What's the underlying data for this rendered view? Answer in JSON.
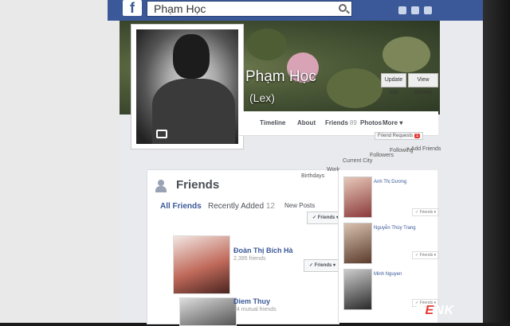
{
  "search": {
    "value": "Phạm Học"
  },
  "logo": {
    "letter": "f"
  },
  "profile": {
    "name": "Phạm Học",
    "alias": "(Lex)"
  },
  "cover_buttons": [
    "Update Info",
    "View Activity"
  ],
  "nav": [
    {
      "label": "Timeline",
      "count": ""
    },
    {
      "label": "About",
      "count": ""
    },
    {
      "label": "Friends",
      "count": "89"
    },
    {
      "label": "Photos",
      "count": ""
    },
    {
      "label": "More ▾",
      "count": ""
    }
  ],
  "friend_requests": {
    "label": "Friend Requests",
    "badge": "1"
  },
  "right_tabs": [
    "+ Add Friends",
    "Following"
  ],
  "friends_section": {
    "title": "Friends",
    "tabs": [
      {
        "label": "All Friends"
      },
      {
        "label": "Recently Added",
        "count": "12"
      },
      {
        "label": "New Posts"
      },
      {
        "label": "Birthdays"
      },
      {
        "label": "Work"
      },
      {
        "label": "Current City"
      },
      {
        "label": "Followers"
      },
      {
        "label": "Following"
      }
    ],
    "list": [
      {
        "name": "Đoàn Thị Bích Hà",
        "sub": "2,395 friends",
        "button": "✓ Friends ▾"
      },
      {
        "name": "Diem Thuy",
        "sub": "24 mutual friends",
        "button": "✓ Friends ▾"
      }
    ],
    "side_list": [
      {
        "name": "Anh Thị Dương",
        "button": "✓ Friends ▾"
      },
      {
        "name": "Nguyễn Thùy Trang",
        "button": "✓ Friends ▾"
      },
      {
        "name": "Minh Nguyen",
        "button": "✓ Friends ▾"
      }
    ],
    "top_button": "✓ Friends ▾"
  },
  "watermark": {
    "prefix": "G",
    "e": "E",
    "suffix": "NK"
  },
  "colors": {
    "facebook_blue": "#3b5998",
    "page_bg": "#e9eaed",
    "badge_red": "#e53935"
  }
}
